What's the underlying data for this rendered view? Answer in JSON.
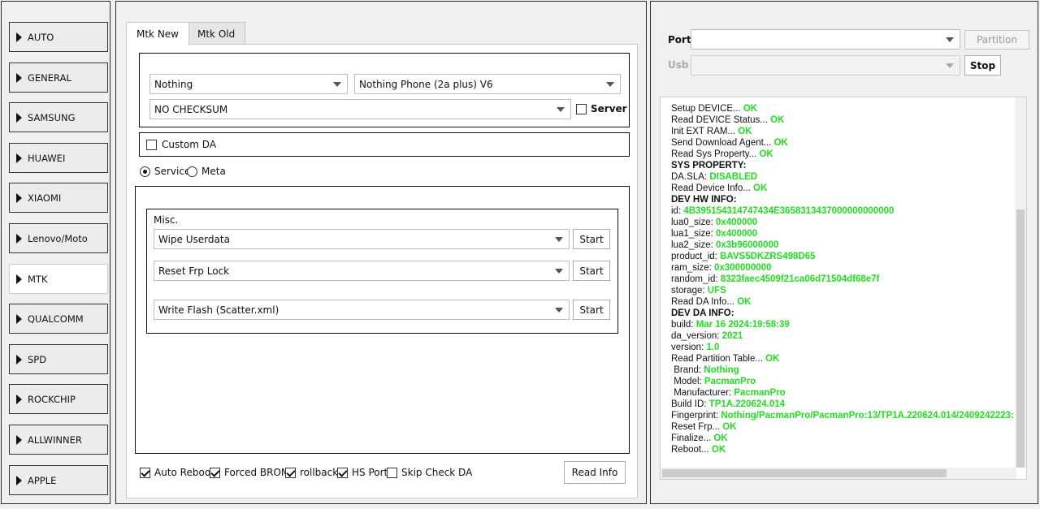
{
  "sidebar": {
    "items": [
      {
        "label": "AUTO"
      },
      {
        "label": "GENERAL"
      },
      {
        "label": "SAMSUNG"
      },
      {
        "label": "HUAWEI"
      },
      {
        "label": "XIAOMI"
      },
      {
        "label": "Lenovo/Moto"
      },
      {
        "label": "MTK",
        "active": true
      },
      {
        "label": "QUALCOMM"
      },
      {
        "label": "SPD"
      },
      {
        "label": "ROCKCHIP"
      },
      {
        "label": "ALLWINNER"
      },
      {
        "label": "APPLE"
      }
    ]
  },
  "tabs": {
    "new": "Mtk New",
    "old": "Mtk Old"
  },
  "device": {
    "brand": "Nothing",
    "model": "Nothing Phone (2a plus)  V6",
    "checksum": "NO CHECKSUM",
    "server_label": "Server",
    "custom_da_label": "Custom DA",
    "mode_service": "Service",
    "mode_meta": "Meta"
  },
  "misc": {
    "title": "Misc.",
    "rows": [
      {
        "value": "Wipe Userdata",
        "button": "Start"
      },
      {
        "value": "Reset Frp Lock",
        "button": "Start"
      },
      {
        "value": "Write Flash (Scatter.xml)",
        "button": "Start"
      }
    ]
  },
  "options": {
    "auto_reboot": "Auto Reboot",
    "forced_brom": "Forced BROM",
    "rollback": "rollback",
    "hs_port": "HS Port",
    "skip_check_da": "Skip Check DA",
    "read_info": "Read Info"
  },
  "connection": {
    "port_label": "Port",
    "usb_label": "Usb",
    "partition_button": "Partition",
    "stop_button": "Stop"
  },
  "log": [
    {
      "k": "Setup DEVICE... ",
      "v": "OK"
    },
    {
      "k": "Read DEVICE Status... ",
      "v": "OK"
    },
    {
      "k": "Init EXT RAM... ",
      "v": "OK"
    },
    {
      "k": "Send Download Agent... ",
      "v": "OK"
    },
    {
      "k": "Read Sys Property... ",
      "v": "OK"
    },
    {
      "k": "SYS PROPERTY:",
      "v": "",
      "h": true
    },
    {
      "k": "DA.SLA: ",
      "v": "DISABLED"
    },
    {
      "k": "Read Device Info... ",
      "v": "OK"
    },
    {
      "k": "DEV HW INFO:",
      "v": "",
      "h": true
    },
    {
      "k": "id: ",
      "v": "4B395154314747434E3658313437000000000000"
    },
    {
      "k": "lua0_size: ",
      "v": "0x400000"
    },
    {
      "k": "lua1_size: ",
      "v": "0x400000"
    },
    {
      "k": "lua2_size: ",
      "v": "0x3b96000000"
    },
    {
      "k": "product_id: ",
      "v": "BAVS5DKZRS498D65"
    },
    {
      "k": "ram_size: ",
      "v": "0x300000000"
    },
    {
      "k": "random_id: ",
      "v": "8323faec4509f21ca06d71504df68e7f"
    },
    {
      "k": "storage: ",
      "v": "UFS"
    },
    {
      "k": "Read DA Info... ",
      "v": "OK"
    },
    {
      "k": "DEV DA INFO:",
      "v": "",
      "h": true
    },
    {
      "k": "build: ",
      "v": "Mar 16 2024:19:58:39"
    },
    {
      "k": "da_version: ",
      "v": "2021"
    },
    {
      "k": "version: ",
      "v": "1.0"
    },
    {
      "k": "Read Partition Table... ",
      "v": "OK"
    },
    {
      "k": " Brand: ",
      "v": "Nothing"
    },
    {
      "k": " Model: ",
      "v": "PacmanPro"
    },
    {
      "k": " Manufacturer: ",
      "v": "PacmanPro"
    },
    {
      "k": "Build ID: ",
      "v": "TP1A.220624.014"
    },
    {
      "k": "Fingerprint: ",
      "v": "Nothing/PacmanPro/PacmanPro:13/TP1A.220624.014/2409242223:"
    },
    {
      "k": "Reset Frp... ",
      "v": "OK"
    },
    {
      "k": "Finalize... ",
      "v": "OK"
    },
    {
      "k": "Reboot... ",
      "v": "OK"
    }
  ]
}
